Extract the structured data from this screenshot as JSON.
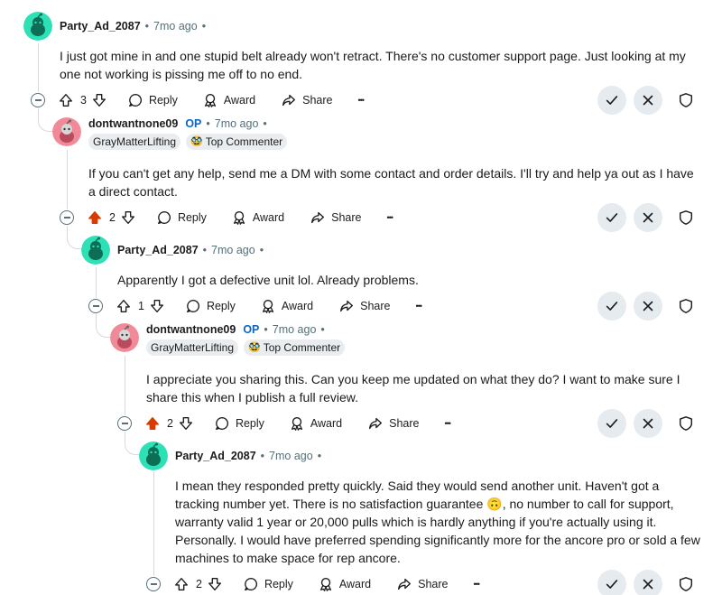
{
  "comments": [
    {
      "username": "Party_Ad_2087",
      "time": "7mo ago",
      "op": "",
      "flair": "",
      "flair_badge": "",
      "body_lines": [
        "I just got mine in and one stupid belt already won't retract. There's no customer support page. Just looking at my",
        "one not working is pissing me off to no end."
      ],
      "votes": "3",
      "upvoted": false
    },
    {
      "username": "dontwantnone09",
      "time": "7mo ago",
      "op": "OP",
      "flair": "GrayMatterLifting",
      "flair_badge": "Top Commenter",
      "body_lines": [
        "If you can't get any help, send me a DM with some contact and order details. I'll try and help ya out as I have",
        "a direct contact."
      ],
      "votes": "2",
      "upvoted": true
    },
    {
      "username": "Party_Ad_2087",
      "time": "7mo ago",
      "op": "",
      "flair": "",
      "flair_badge": "",
      "body_lines": [
        "Apparently I got a defective unit lol. Already problems."
      ],
      "votes": "1",
      "upvoted": false
    },
    {
      "username": "dontwantnone09",
      "time": "7mo ago",
      "op": "OP",
      "flair": "GrayMatterLifting",
      "flair_badge": "Top Commenter",
      "body_lines": [
        "I appreciate you sharing this. Can you keep me updated on what they do? I want to make sure I",
        "share this when I publish a full review."
      ],
      "votes": "2",
      "upvoted": true
    },
    {
      "username": "Party_Ad_2087",
      "time": "7mo ago",
      "op": "",
      "flair": "",
      "flair_badge": "",
      "body_lines": [
        "I mean they responded pretty quickly. Said they would send another unit. Haven't got a",
        "tracking number yet. There is no satisfaction guarantee 🙃, no number to call for support,",
        "warranty valid 1 year or 20,000 pulls which is hardly anything if you're actually using it.",
        "Personally. I would have preferred spending significantly more for the ancore pro or sold a few",
        "machines to make space for rep ancore."
      ],
      "votes": "2",
      "upvoted": false
    }
  ],
  "labels": {
    "reply": "Reply",
    "award": "Award",
    "share": "Share",
    "more": "•••",
    "separator": "•"
  },
  "icons": {
    "upvote": "arrow-up-icon",
    "downvote": "arrow-down-icon",
    "reply": "comment-bubble-icon",
    "award": "award-icon",
    "share": "share-arrow-icon",
    "approve": "checkmark-icon",
    "remove": "x-close-icon",
    "mod": "shield-icon"
  },
  "colors": {
    "upvote_active": "#d93a00",
    "mod_button_bg": "#e5ebee",
    "op_blue": "#0a66c2",
    "avatar_green": "#2ee0b5",
    "avatar_pink": "#f08a98"
  }
}
